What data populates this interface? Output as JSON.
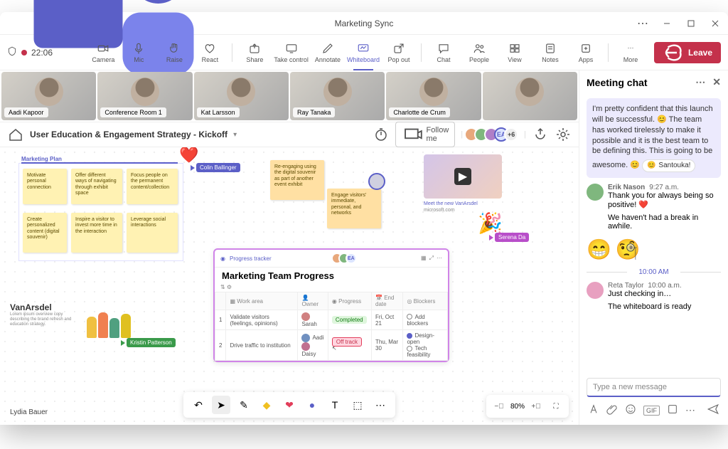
{
  "titlebar": {
    "title": "Marketing Sync"
  },
  "toolbar": {
    "timer": "22:06",
    "camera": "Camera",
    "mic": "Mic",
    "raise": "Raise",
    "react": "React",
    "share": "Share",
    "take_control": "Take control",
    "annotate": "Annotate",
    "whiteboard": "Whiteboard",
    "popout": "Pop out",
    "chat": "Chat",
    "people": "People",
    "view": "View",
    "notes": "Notes",
    "apps": "Apps",
    "more": "More",
    "leave": "Leave"
  },
  "videos": [
    {
      "name": "Aadi Kapoor"
    },
    {
      "name": "Conference Room 1"
    },
    {
      "name": "Kat Larsson"
    },
    {
      "name": "Ray Tanaka"
    },
    {
      "name": "Charlotte de Crum"
    },
    {
      "name": ""
    }
  ],
  "whiteboard": {
    "title": "User Education & Engagement Strategy - Kickoff",
    "follow": "Follow me",
    "plus_count": "+6",
    "zoom": "80%",
    "user_label": "Lydia Bauer",
    "section1": "Marketing Plan",
    "stickies_a": [
      "Motivate personal connection",
      "Offer different ways of navigating through exhibit space",
      "Focus people on the permanent content/collection",
      "Create personalized content (digital souvenir)",
      "Inspire a visitor to invest more time in the interaction",
      "Leverage social interactions"
    ],
    "stickies_b": [
      "Re-engaging using the digital souvenir as part of another event exhibit",
      "Engage visitors' immediate, personal, and networks"
    ],
    "cursors": {
      "colin": "Colin Ballinger",
      "kristin": "Kristin Patterson",
      "serena": "Serena Da"
    },
    "vanarsdel": {
      "brand": "VanArsdel"
    },
    "thumb_caption": "Meet the new VanArsdel",
    "thumb_site": "microsoft.com",
    "tracker": {
      "label": "Progress tracker",
      "title": "Marketing Team Progress",
      "cols": [
        "Work area",
        "Owner",
        "Progress",
        "End date",
        "Blockers"
      ],
      "rows": [
        {
          "n": "1",
          "area": "Validate visitors (feelings, opinions)",
          "owners": [
            "Sarah"
          ],
          "progress": "Completed",
          "end": "Fri, Oct 21",
          "blockers": [
            "Add blockers"
          ]
        },
        {
          "n": "2",
          "area": "Drive traffic to institution",
          "owners": [
            "Aadi",
            "Daisy"
          ],
          "progress": "Off track",
          "end": "Thu, Mar 30",
          "blockers": [
            "Design-open",
            "Tech feasibility"
          ]
        }
      ]
    }
  },
  "chat": {
    "title": "Meeting chat",
    "confident_msg": "I'm pretty confident that this launch will be successful. 😊 The team has worked tirelessly to make it possible and it is the best team to be defining this. This is going to be awesome. 😊",
    "reaction": "Santouka!",
    "erik": {
      "name": "Erik Nason",
      "time": "9:27 a.m.",
      "line1": "Thank you for always being so positive! ❤️",
      "line2": "We haven't had a break in awhile."
    },
    "divider_time": "10:00 AM",
    "reta": {
      "name": "Reta Taylor",
      "time": "10:00 a.m.",
      "line1": "Just checking in…",
      "line2": "The whiteboard is ready"
    },
    "placeholder": "Type a new message"
  }
}
